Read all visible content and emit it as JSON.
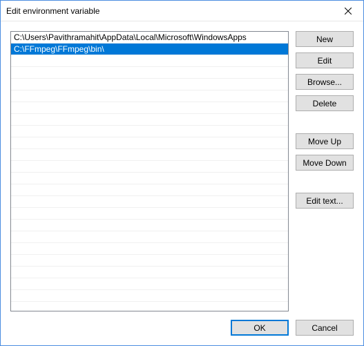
{
  "window": {
    "title": "Edit environment variable"
  },
  "paths": [
    "C:\\Users\\Pavithramahit\\AppData\\Local\\Microsoft\\WindowsApps",
    "C:\\FFmpeg\\FFmpeg\\bin\\"
  ],
  "selected_index": 1,
  "buttons": {
    "new": "New",
    "edit": "Edit",
    "browse": "Browse...",
    "delete": "Delete",
    "move_up": "Move Up",
    "move_down": "Move Down",
    "edit_text": "Edit text...",
    "ok": "OK",
    "cancel": "Cancel"
  },
  "icons": {
    "close": "close"
  }
}
